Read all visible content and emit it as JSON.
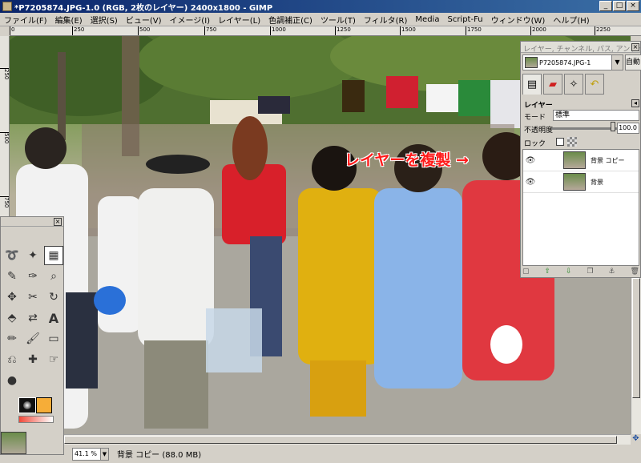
{
  "window": {
    "title": "*P7205874.JPG-1.0 (RGB, 2枚のレイヤー) 2400x1800 - GIMP",
    "buttons": {
      "minimize": "_",
      "maximize": "□",
      "close": "×"
    }
  },
  "menu": [
    "ファイル(F)",
    "編集(E)",
    "選択(S)",
    "ビュー(V)",
    "イメージ(I)",
    "レイヤー(L)",
    "色調補正(C)",
    "ツール(T)",
    "フィルタ(R)",
    "Media",
    "Script-Fu",
    "ウィンドウ(W)",
    "ヘルプ(H)"
  ],
  "ruler": {
    "top": [
      "0",
      "250",
      "500",
      "750",
      "1000",
      "1250",
      "1500",
      "1750",
      "2000",
      "2250"
    ],
    "left": [
      "250",
      "500",
      "750"
    ]
  },
  "annotation": "レイヤーを複製 →",
  "layers_dock": {
    "title": "レイヤー, チャンネル, パス, アンドゥ",
    "image_name": "P7205874.JPG-1",
    "auto_button": "自動",
    "section_label": "レイヤー",
    "mode_label": "モード",
    "mode_value": "標準",
    "opacity_label": "不透明度",
    "opacity_value": "100.0",
    "lock_label": "ロック",
    "layers": [
      {
        "name": "背景 コピー"
      },
      {
        "name": "背景"
      }
    ]
  },
  "status": {
    "zoom": "41.1 %",
    "message": "背景 コピー (88.0 MB)"
  },
  "colors": {
    "foreground": "#111111",
    "background": "#f6ad38",
    "annotation": "#ff1a1a"
  }
}
